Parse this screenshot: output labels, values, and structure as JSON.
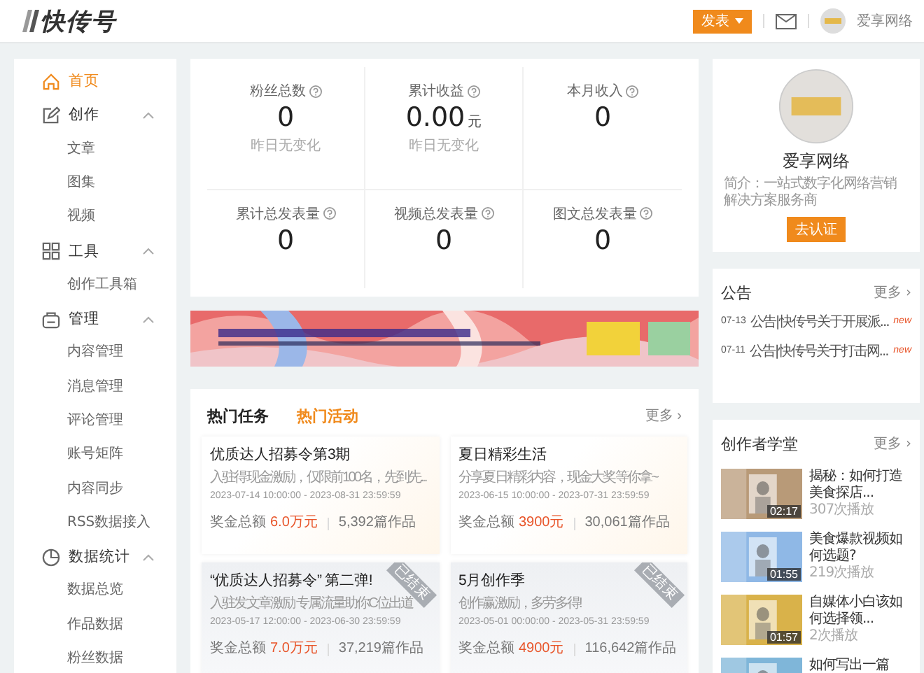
{
  "header": {
    "logo": "快传号",
    "publish_button": "发表",
    "user_name": "爱享网络"
  },
  "sidebar": {
    "items": [
      {
        "label": "首页",
        "selected": true
      },
      {
        "label": "创作",
        "selected": false,
        "expanded": true,
        "children": [
          {
            "label": "文章"
          },
          {
            "label": "图集"
          },
          {
            "label": "视频"
          }
        ]
      },
      {
        "label": "工具",
        "selected": false,
        "expanded": true,
        "children": [
          {
            "label": "创作工具箱"
          }
        ]
      },
      {
        "label": "管理",
        "selected": false,
        "expanded": true,
        "children": [
          {
            "label": "内容管理"
          },
          {
            "label": "消息管理"
          },
          {
            "label": "评论管理"
          },
          {
            "label": "账号矩阵"
          },
          {
            "label": "内容同步"
          },
          {
            "label": "RSS数据接入"
          }
        ]
      },
      {
        "label": "数据统计",
        "selected": false,
        "expanded": true,
        "children": [
          {
            "label": "数据总览"
          },
          {
            "label": "作品数据"
          },
          {
            "label": "粉丝数据"
          }
        ]
      }
    ]
  },
  "stats": [
    {
      "label": "粉丝总数",
      "value": "0",
      "note": "昨日无变化"
    },
    {
      "label": "累计收益",
      "value": "0.00",
      "unit": "元",
      "note": "昨日无变化"
    },
    {
      "label": "本月收入",
      "value": "0"
    },
    {
      "label": "累计总发表量",
      "value": "0"
    },
    {
      "label": "视频总发表量",
      "value": "0"
    },
    {
      "label": "图文总发表量",
      "value": "0"
    }
  ],
  "tasks": {
    "tabs": [
      {
        "label": "热门任务",
        "selected": false
      },
      {
        "label": "热门活动",
        "selected": true
      }
    ],
    "more": "更多 ›",
    "cards": [
      {
        "title": "优质达人招募令第3期",
        "desc": "入驻得现金激励，仅限前100名，先到先...",
        "period": "2023-07-14 10:00:00 - 2023-08-31 23:59:59",
        "prize_label": "奖金总额",
        "prize": "6.0万元",
        "works": "5,392篇作品",
        "ended": false
      },
      {
        "title": "夏日精彩生活",
        "desc": "分享夏日精彩内容，现金大奖等你拿~",
        "period": "2023-06-15 10:00:00 - 2023-07-31 23:59:59",
        "prize_label": "奖金总额",
        "prize": "3900元",
        "works": "30,061篇作品",
        "ended": false
      },
      {
        "title": "“优质达人招募令” 第二弹!",
        "desc": "入驻发文章激励 专属流量助你C位出道",
        "period": "2023-05-17 12:00:00 - 2023-06-30 23:59:59",
        "prize_label": "奖金总额",
        "prize": "7.0万元",
        "works": "37,219篇作品",
        "ended": true,
        "ribbon": "已结束"
      },
      {
        "title": "5月创作季",
        "desc": "创作赢激励，多劳多得!",
        "period": "2023-05-01 00:00:00 - 2023-05-31 23:59:59",
        "prize_label": "奖金总额",
        "prize": "4900元",
        "works": "116,642篇作品",
        "ended": true,
        "ribbon": "已结束"
      }
    ]
  },
  "profile": {
    "name": "爱享网络",
    "intro": "简介：一站式数字化网络营销解决方案服务商",
    "verify_button": "去认证"
  },
  "announcements": {
    "title": "公告",
    "more": "更多 ›",
    "items": [
      {
        "date": "07-13",
        "text": "公告|快传号关于开展派...",
        "badge": "new"
      },
      {
        "date": "07-11",
        "text": "公告|快传号关于打击网...",
        "badge": "new"
      }
    ]
  },
  "academy": {
    "title": "创作者学堂",
    "more": "更多 ›",
    "videos": [
      {
        "title": "揭秘：如何打造美食探店...",
        "duration": "02:17",
        "plays": "307次播放"
      },
      {
        "title": "美食爆款视频如何选题?",
        "duration": "01:55",
        "plays": "219次播放"
      },
      {
        "title": "自媒体小白该如何选择领...",
        "duration": "01:57",
        "plays": "2次播放"
      },
      {
        "title": "如何写出一篇"
      }
    ]
  }
}
